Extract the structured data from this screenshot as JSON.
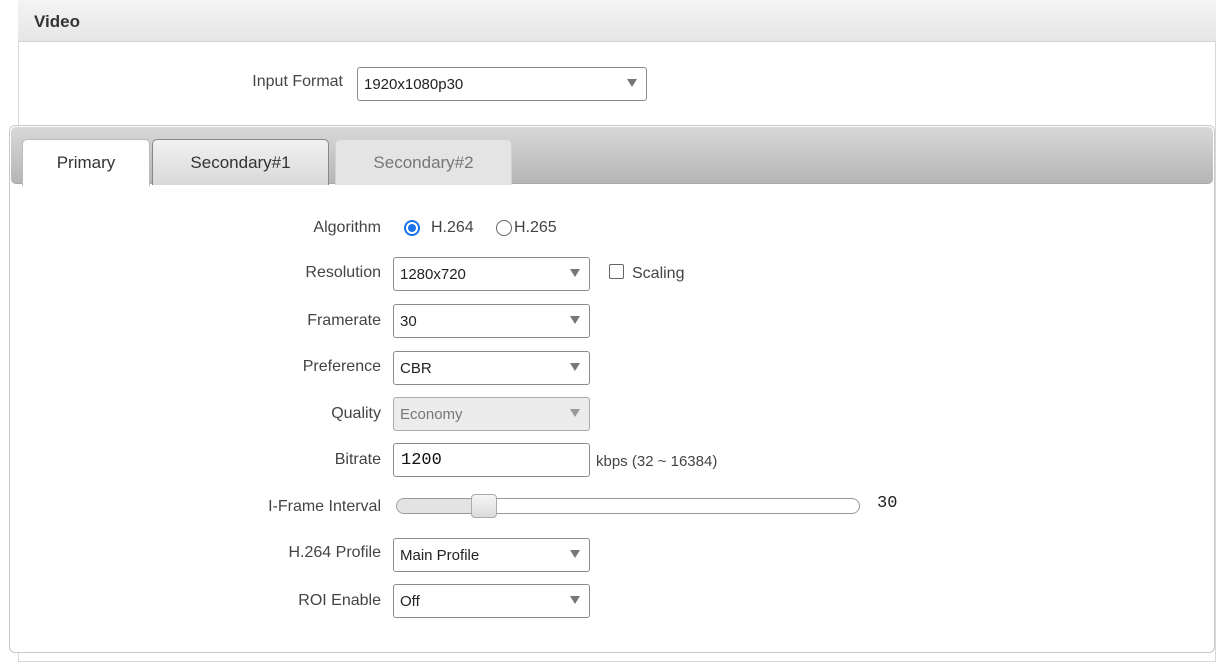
{
  "section": {
    "title": "Video"
  },
  "input_format": {
    "label": "Input Format",
    "value": "1920x1080p30"
  },
  "tabs": [
    {
      "label": "Primary",
      "state": "active"
    },
    {
      "label": "Secondary#1",
      "state": "normal"
    },
    {
      "label": "Secondary#2",
      "state": "disabled"
    }
  ],
  "algorithm": {
    "label": "Algorithm",
    "options": [
      "H.264",
      "H.265"
    ],
    "selected": "H.264"
  },
  "resolution": {
    "label": "Resolution",
    "value": "1280x720",
    "scaling_label": "Scaling",
    "scaling_checked": false
  },
  "framerate": {
    "label": "Framerate",
    "value": "30"
  },
  "preference": {
    "label": "Preference",
    "value": "CBR"
  },
  "quality": {
    "label": "Quality",
    "value": "Economy",
    "disabled": true
  },
  "bitrate": {
    "label": "Bitrate",
    "value": "1200",
    "hint": "kbps (32 ~ 16384)"
  },
  "iframe_interval": {
    "label": "I-Frame Interval",
    "value": "30"
  },
  "h264_profile": {
    "label": "H.264 Profile",
    "value": "Main Profile"
  },
  "roi_enable": {
    "label": "ROI Enable",
    "value": "Off"
  },
  "colors": {
    "accent": "#1a73e8",
    "header_bg": "#e6e6e6"
  }
}
